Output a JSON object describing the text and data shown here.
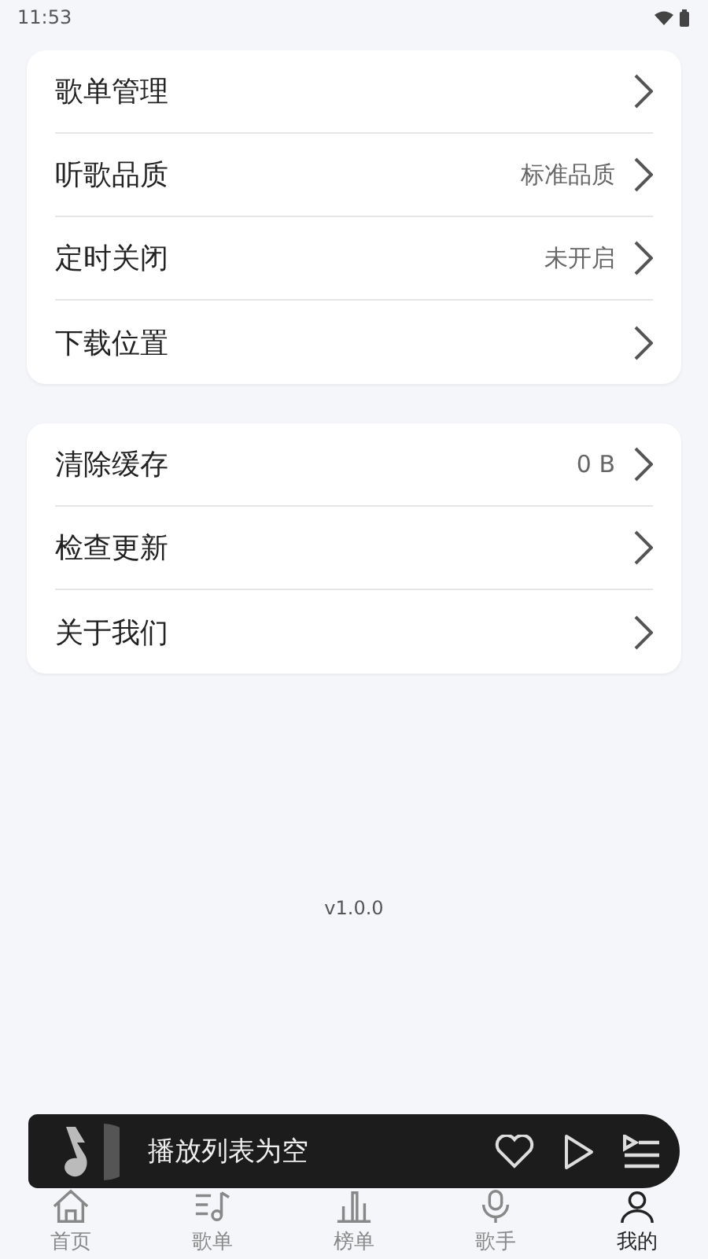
{
  "status_bar": {
    "time": "11:53"
  },
  "groups": [
    {
      "items": [
        {
          "label": "歌单管理"
        },
        {
          "label": "听歌品质",
          "value": "标准品质"
        },
        {
          "label": "定时关闭",
          "value": "未开启"
        },
        {
          "label": "下载位置"
        }
      ]
    },
    {
      "items": [
        {
          "label": "清除缓存",
          "value": "0 B"
        },
        {
          "label": "检查更新"
        },
        {
          "label": "关于我们"
        }
      ]
    }
  ],
  "version": "v1.0.0",
  "player": {
    "title": "播放列表为空"
  },
  "nav": [
    {
      "label": "首页",
      "kind": "home",
      "selected": false
    },
    {
      "label": "歌单",
      "kind": "playlist",
      "selected": false
    },
    {
      "label": "榜单",
      "kind": "chart",
      "selected": false
    },
    {
      "label": "歌手",
      "kind": "mic",
      "selected": false
    },
    {
      "label": "我的",
      "kind": "user",
      "selected": true
    }
  ]
}
